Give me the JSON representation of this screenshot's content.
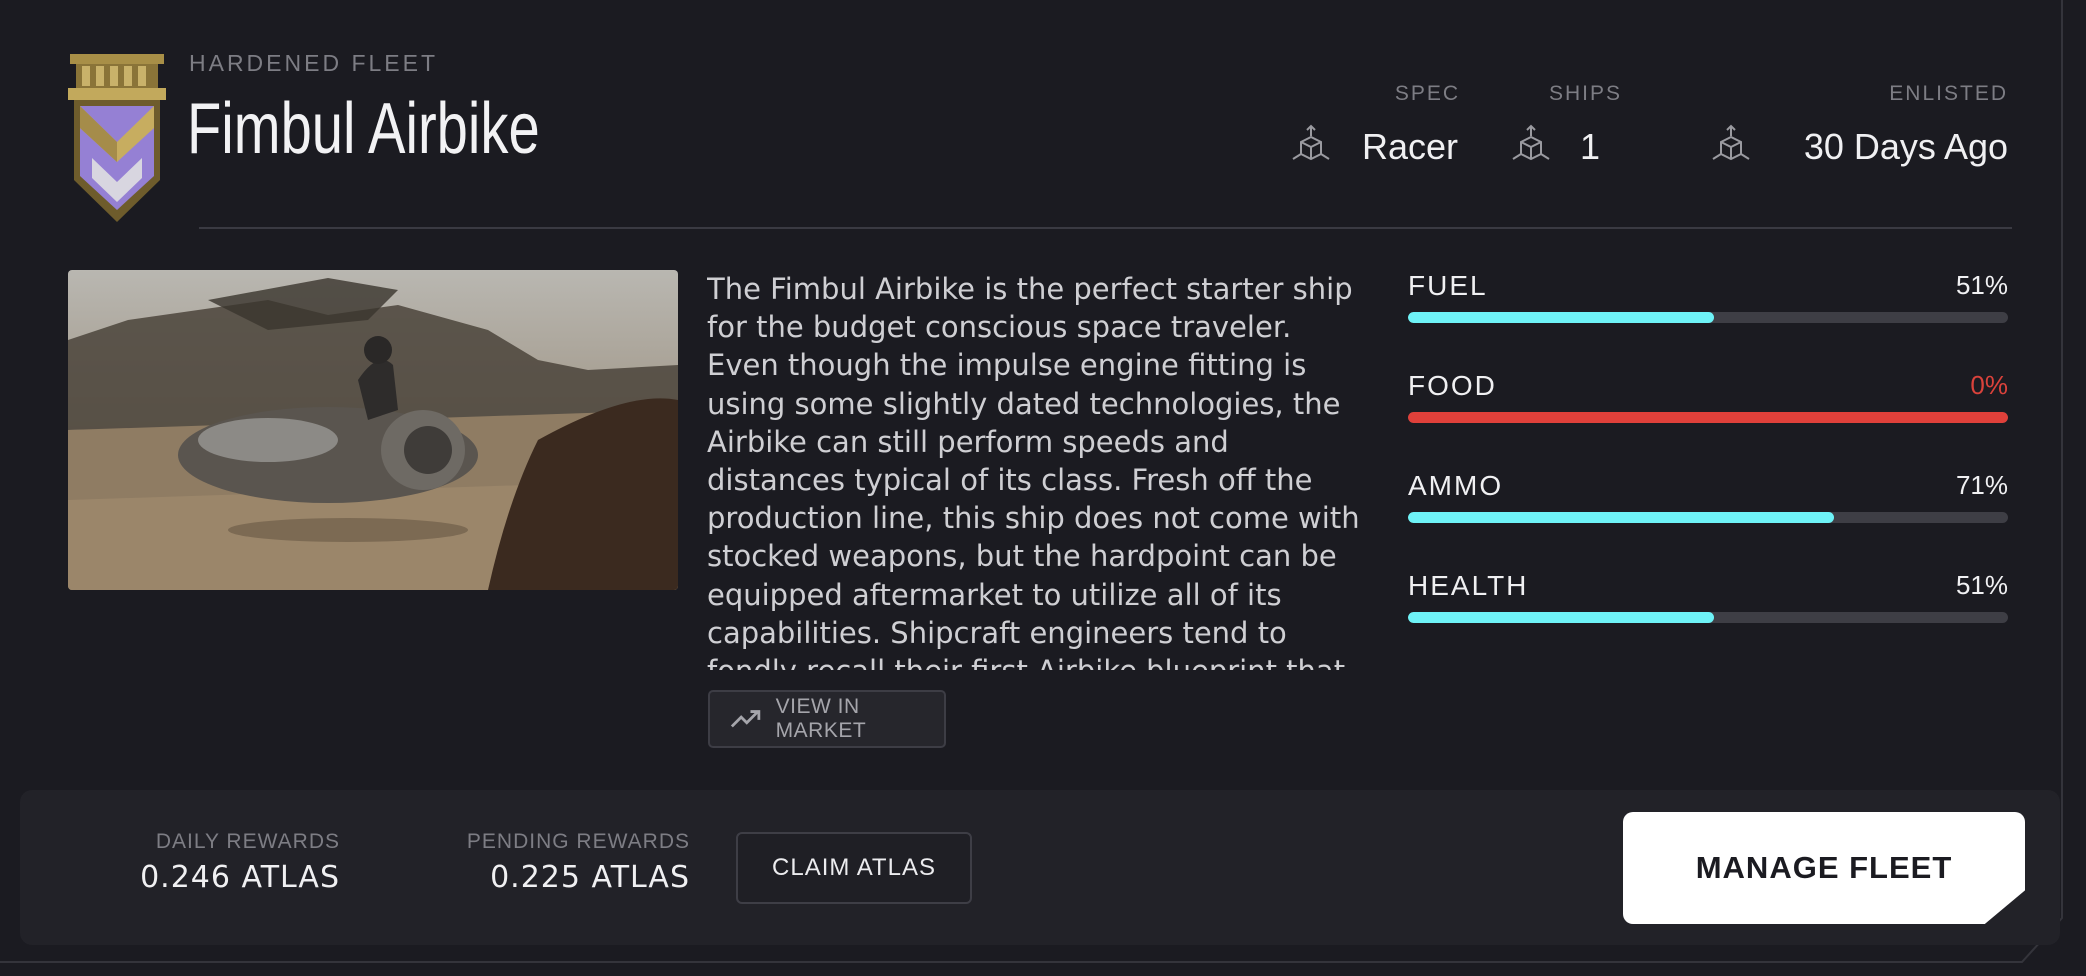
{
  "header": {
    "fleet_tier": "HARDENED FLEET",
    "ship_name": "Fimbul Airbike",
    "stats": [
      {
        "label": "SPEC",
        "value": "Racer",
        "icon": "cube-icon"
      },
      {
        "label": "SHIPS",
        "value": "1",
        "icon": "cube-icon"
      },
      {
        "label": "ENLISTED",
        "value": "30 Days Ago",
        "icon": "cube-icon"
      }
    ]
  },
  "description": "The Fimbul Airbike is the perfect starter ship for the budget conscious space traveler. Even though the impulse engine fitting is using some slightly dated technologies, the Airbike can still perform speeds and distances typical of its class. Fresh off the production line, this ship does not come with stocked weapons, but the hardpoint can be equipped aftermarket to utilize all of its capabilities. Shipcraft engineers tend to fondly recall their first Airbike blueprint that",
  "market_button": {
    "label": "VIEW IN MARKET",
    "icon": "trend-up-icon"
  },
  "resources": [
    {
      "label": "FUEL",
      "percent_text": "51%",
      "fraction": 0.51,
      "status": "ok"
    },
    {
      "label": "FOOD",
      "percent_text": "0%",
      "fraction": 0.0,
      "status": "empty"
    },
    {
      "label": "AMMO",
      "percent_text": "71%",
      "fraction": 0.71,
      "status": "ok"
    },
    {
      "label": "HEALTH",
      "percent_text": "51%",
      "fraction": 0.51,
      "status": "ok"
    }
  ],
  "rewards": {
    "daily_label": "DAILY REWARDS",
    "daily_value": "0.246 ATLAS",
    "pending_label": "PENDING REWARDS",
    "pending_value": "0.225 ATLAS"
  },
  "buttons": {
    "claim": "CLAIM ATLAS",
    "manage": "MANAGE FLEET"
  },
  "colors": {
    "background": "#1b1b21",
    "panel": "#222228",
    "bar_fill": "#6ef3f7",
    "bar_empty_alert": "#e0403a",
    "alert_text": "#d9423b",
    "emblem_gold": "#b39a4f",
    "emblem_purple": "#8b78c9"
  }
}
